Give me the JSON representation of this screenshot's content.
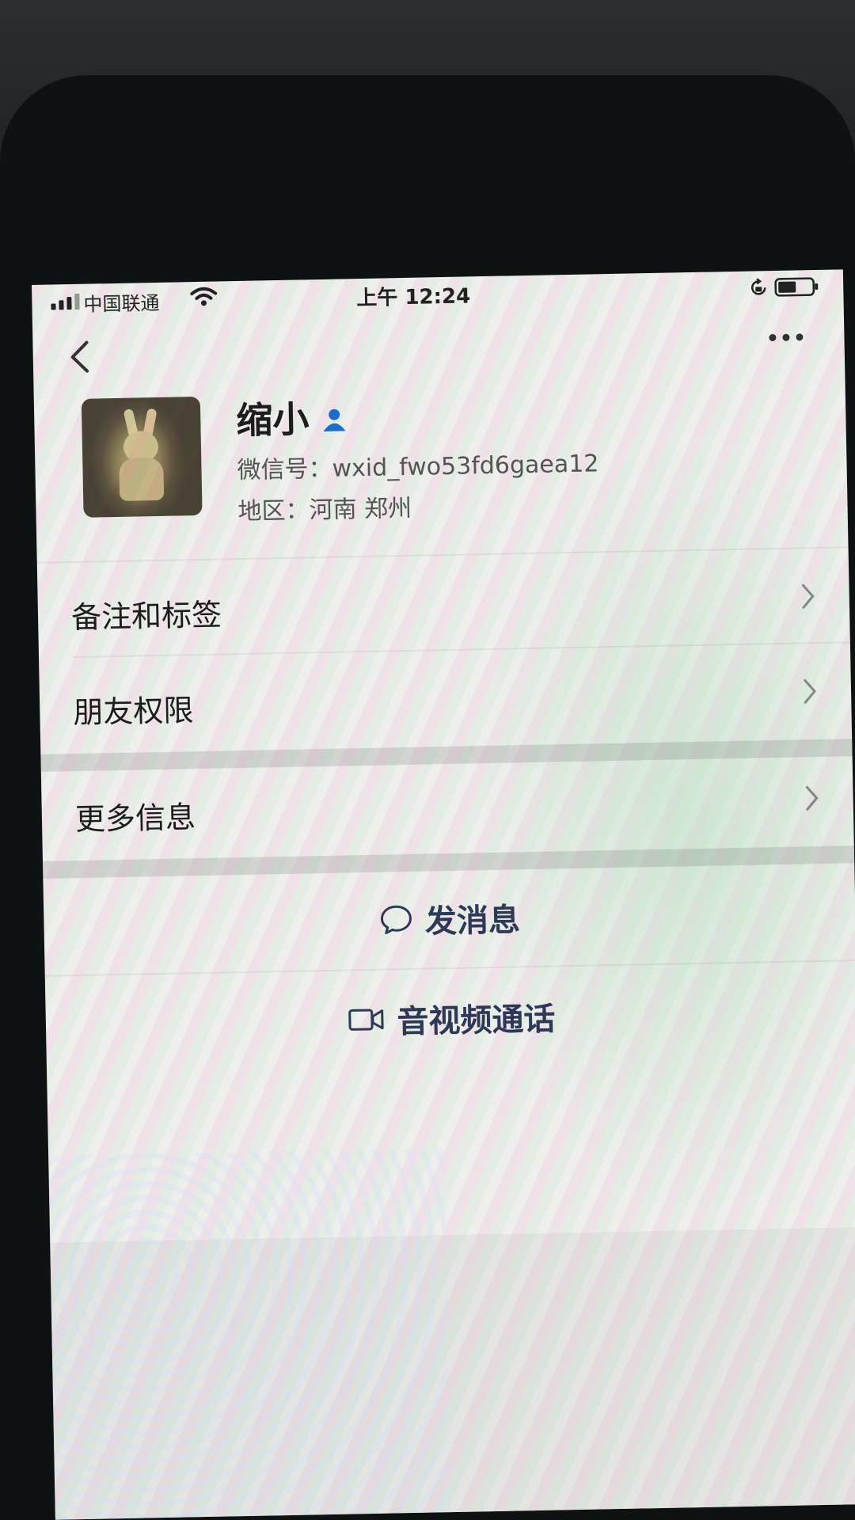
{
  "status_bar": {
    "carrier": "中国联通",
    "time": "上午 12:24"
  },
  "profile": {
    "nickname": "缩小",
    "wechat_id": "微信号：wxid_fwo53fd6gaea12",
    "region": "地区：河南 郑州"
  },
  "menu": {
    "items": [
      {
        "label": "备注和标签"
      },
      {
        "label": "朋友权限"
      },
      {
        "label": "更多信息"
      }
    ]
  },
  "actions": {
    "send_message": "发消息",
    "video_call": "音视频通话"
  },
  "icons": {
    "back": "back-icon",
    "more": "more-icon",
    "contact": "contact-icon",
    "message": "message-icon",
    "video": "video-icon"
  },
  "colors": {
    "accent": "#1f6fd0",
    "action_text": "#2e3a57"
  }
}
